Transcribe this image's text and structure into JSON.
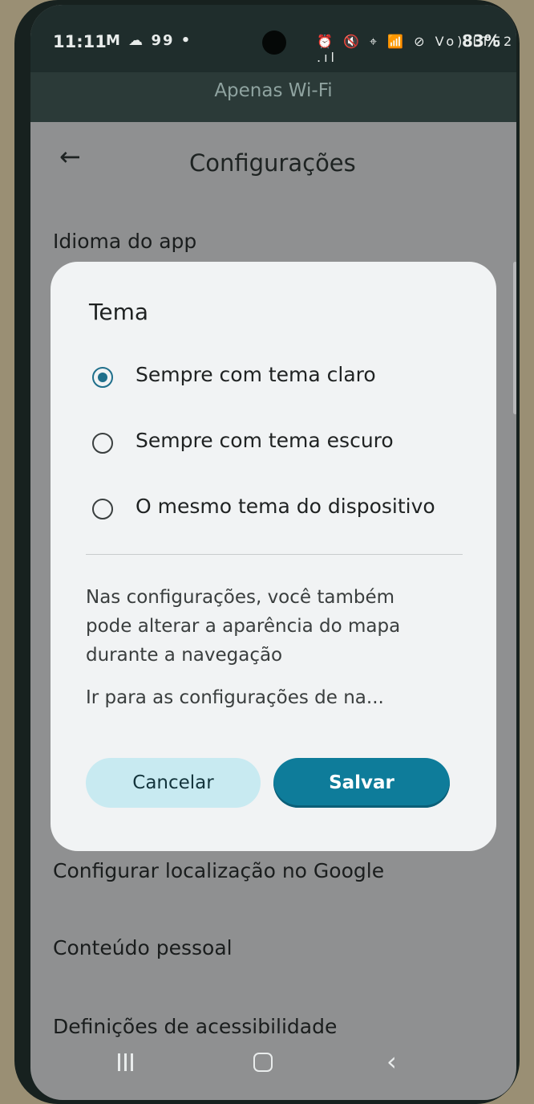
{
  "status_bar": {
    "time": "11:11",
    "left_icons": "M ☁ 99 •",
    "right_icons": "⏰ 🔇 ⌖ 📶 ⊘ Vo) LTE2 .ıl",
    "battery": "83%"
  },
  "banner": {
    "text": "Apenas Wi-Fi"
  },
  "app_bar": {
    "back_icon": "arrow-left",
    "title": "Configurações"
  },
  "settings_items": [
    "Idioma do app",
    "Configurar localização no Google",
    "Conteúdo pessoal",
    "Definições de acessibilidade"
  ],
  "dialog": {
    "title": "Tema",
    "options": [
      {
        "label": "Sempre com tema claro",
        "selected": true
      },
      {
        "label": "Sempre com tema escuro",
        "selected": false
      },
      {
        "label": "O mesmo tema do dispositivo",
        "selected": false
      }
    ],
    "info_lines": [
      "Nas configurações, você também",
      "pode alterar a aparência do mapa",
      "durante a navegação"
    ],
    "nav_settings_link": "Ir para as configurações de na...",
    "cancel_label": "Cancelar",
    "save_label": "Salvar"
  },
  "nav_bar": {
    "recents_icon": "recents",
    "home_icon": "home",
    "back_icon": "back"
  },
  "colors": {
    "accent": "#0e7c9a",
    "cancel_bg": "#c8eaf1",
    "scrim": "#8f9091",
    "dialog_bg": "#f1f3f4"
  }
}
